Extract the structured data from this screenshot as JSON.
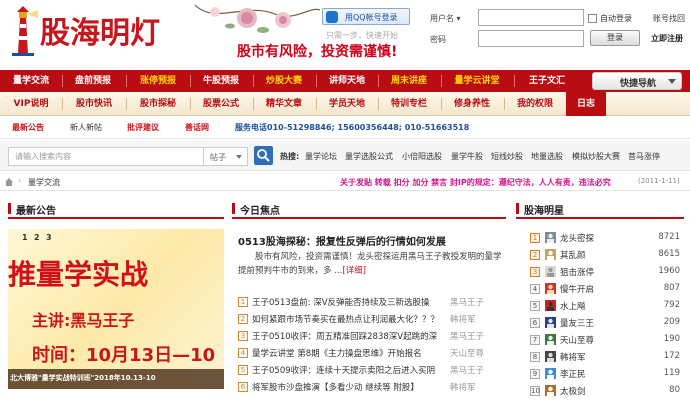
{
  "site": {
    "name": "股海明灯",
    "slogan": "股市有风险，投资需谨慎!",
    "qq_login": "用QQ帐号登录",
    "one_step": "只需一步，快速开始"
  },
  "login": {
    "user_label": "用户名",
    "pass_label": "密码",
    "user_dropdown": "▾",
    "auto_login": "自动登录",
    "account_help": "账号找回",
    "login_button": "登录",
    "register": "立即注册"
  },
  "nav_primary": [
    "量学交流",
    "盘前预报",
    "涨停预报",
    "牛股预报",
    "炒股大赛",
    "讲师天地",
    "周末讲座",
    "量学云讲堂",
    "王子文汇"
  ],
  "quick_nav": "快捷导航",
  "nav_secondary": [
    "VIP说明",
    "股市快讯",
    "股市探秘",
    "股票公式",
    "精华文章",
    "学员天地",
    "特训专栏",
    "修身养性",
    "我的权限",
    "日志"
  ],
  "row3": {
    "items": [
      "最新公告",
      "新人新帖",
      "批评建议",
      "善话网"
    ],
    "service": "服务电话010-51298846; 15600356448; 010-51663518"
  },
  "search": {
    "placeholder": "请输入搜索内容",
    "type": "帖子",
    "hot_label": "热搜:",
    "hot": [
      "量学论坛",
      "量学选股公式",
      "小倍阳选股",
      "量学牛股",
      "短线炒股",
      "地量选股",
      "模拟炒股大赛",
      "菩马涨停"
    ]
  },
  "breadcrumb": {
    "arrow": "›",
    "current": "量学交流",
    "notice": "关于发贴 转载 扣分 加分 禁言 封IP的规定：遵纪守法，人人有责，违法必究",
    "date": "(2011-1-11)"
  },
  "sections": {
    "announcement": "最新公告",
    "focus": "今日焦点",
    "stars": "股海明星"
  },
  "banner": {
    "pages": [
      "1",
      "2",
      "3"
    ],
    "title": "推量学实战",
    "speaker": "主讲:黑马王子",
    "date": "时间：10月13日—10",
    "caption": "北大博雅\"量学实战特训班\"2018年10.13-10"
  },
  "focus": {
    "headline": "0513股海探秘：报复性反弹后的行情如何发展",
    "summary": "股市有风险，投资需谨慎！龙头密探运用黑马王子教授发明的量学提前预判牛市的到来，多 ...",
    "more": "[详细]",
    "news": [
      {
        "n": "1",
        "title": "王子0513盘前: 深V反弹能否持续及三新选股操",
        "author": "黑马王子"
      },
      {
        "n": "2",
        "title": "如何紧跟市场节奏买在最热点让利润最大化？？？",
        "author": "韩将军"
      },
      {
        "n": "3",
        "title": "王子0510收评：周五精准回踩2838深V起跳的深",
        "author": "黑马王子"
      },
      {
        "n": "4",
        "title": "量学云讲堂 第8期《主力操盘思维》开始报名",
        "author": "天山至尊"
      },
      {
        "n": "5",
        "title": "王子0509收评：连续十天提示卖阳之后进入买阴",
        "author": "黑马王子"
      },
      {
        "n": "6",
        "title": "将军股市沙盘推演【多看少动 继续等 附股】",
        "author": "韩将军"
      }
    ]
  },
  "stars": [
    {
      "rank": "1",
      "name": "龙头密探",
      "count": "8721"
    },
    {
      "rank": "2",
      "name": "其乱颜",
      "count": "8615"
    },
    {
      "rank": "3",
      "name": "狙击涨停",
      "count": "1960"
    },
    {
      "rank": "4",
      "name": "慢牛开启",
      "count": "807"
    },
    {
      "rank": "5",
      "name": "水上飚",
      "count": "792"
    },
    {
      "rank": "6",
      "name": "量友三王",
      "count": "209"
    },
    {
      "rank": "7",
      "name": "天山至尊",
      "count": "190"
    },
    {
      "rank": "8",
      "name": "韩将军",
      "count": "172"
    },
    {
      "rank": "9",
      "name": "李正民",
      "count": "119"
    },
    {
      "rank": "10",
      "name": "太极剑",
      "count": "80"
    }
  ],
  "colors": {
    "brand_red": "#b80d12",
    "highlight_yellow": "#ffd800",
    "notice_pink": "#d4128b"
  }
}
